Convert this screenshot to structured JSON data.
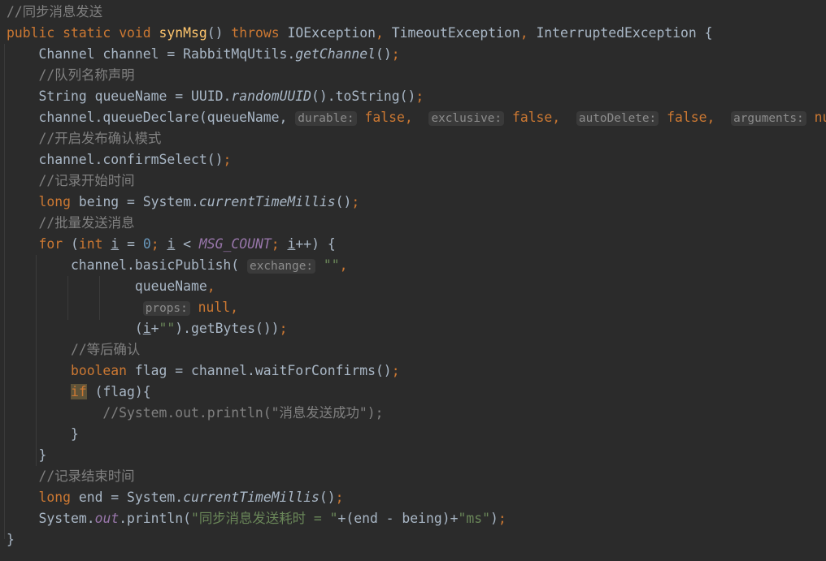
{
  "editor": {
    "language": "java",
    "theme": "darcula",
    "background_color": "#2b2b2b",
    "default_text_color": "#a9b7c6",
    "colors": {
      "keyword": "#cc7832",
      "comment": "#808080",
      "string": "#6a8759",
      "number": "#6897bb",
      "method_declaration": "#ffc66d",
      "static_field": "#9876aa",
      "parameter_hint_text": "#8c8c8c",
      "parameter_hint_background": "#3a3a3a",
      "caret_highlight_background": "#5e5339",
      "indent_guide": "#3b3b3b"
    },
    "lines": [
      {
        "indent": 0,
        "text": "//同步消息发送"
      },
      {
        "indent": 0,
        "text": "public static void synMsg() throws IOException, TimeoutException, InterruptedException {"
      },
      {
        "indent": 1,
        "text": "Channel channel = RabbitMqUtils.getChannel();"
      },
      {
        "indent": 1,
        "text": "//队列名称声明"
      },
      {
        "indent": 1,
        "text": "String queueName = UUID.randomUUID().toString();"
      },
      {
        "indent": 1,
        "text": "channel.queueDeclare(queueName, durable: false, exclusive: false, autoDelete: false, arguments: null);"
      },
      {
        "indent": 1,
        "text": "//开启发布确认模式"
      },
      {
        "indent": 1,
        "text": "channel.confirmSelect();"
      },
      {
        "indent": 1,
        "text": "//记录开始时间"
      },
      {
        "indent": 1,
        "text": "long being = System.currentTimeMillis();"
      },
      {
        "indent": 1,
        "text": "//批量发送消息"
      },
      {
        "indent": 1,
        "text": "for (int i = 0; i < MSG_COUNT; i++) {"
      },
      {
        "indent": 2,
        "text": "channel.basicPublish( exchange: \"\","
      },
      {
        "indent": 4,
        "text": "queueName,"
      },
      {
        "indent": 4,
        "text": " props: null,"
      },
      {
        "indent": 4,
        "text": "(i+\"\").getBytes());"
      },
      {
        "indent": 2,
        "text": "//等后确认"
      },
      {
        "indent": 2,
        "text": "boolean flag = channel.waitForConfirms();"
      },
      {
        "indent": 2,
        "text": "if (flag){"
      },
      {
        "indent": 3,
        "text": "//System.out.println(\"消息发送成功\");"
      },
      {
        "indent": 2,
        "text": "}"
      },
      {
        "indent": 1,
        "text": "}"
      },
      {
        "indent": 1,
        "text": "//记录结束时间"
      },
      {
        "indent": 1,
        "text": "long end = System.currentTimeMillis();"
      },
      {
        "indent": 1,
        "text": "System.out.println(\"同步消息发送耗时 = \"+(end - being)+\"ms\");"
      },
      {
        "indent": 0,
        "text": "}"
      }
    ],
    "parameter_hints": [
      {
        "label": "durable:",
        "value": "false"
      },
      {
        "label": "exclusive:",
        "value": "false"
      },
      {
        "label": "autoDelete:",
        "value": "false"
      },
      {
        "label": "arguments:",
        "value": "null"
      },
      {
        "label": "exchange:",
        "value": "\"\""
      },
      {
        "label": "props:",
        "value": "null"
      }
    ],
    "highlighted_token": "if",
    "comments": [
      "//同步消息发送",
      "//队列名称声明",
      "//开启发布确认模式",
      "//记录开始时间",
      "//批量发送消息",
      "//等后确认",
      "//System.out.println(\"消息发送成功\");",
      "//记录结束时间"
    ],
    "strings": [
      "\"\"",
      "\"\"",
      "\"同步消息发送耗时 = \"",
      "\"ms\""
    ],
    "identifiers": {
      "method_name": "synMsg",
      "exceptions": [
        "IOException",
        "TimeoutException",
        "InterruptedException"
      ],
      "types": [
        "Channel",
        "String",
        "long",
        "int",
        "boolean",
        "void"
      ],
      "variables": [
        "channel",
        "queueName",
        "being",
        "i",
        "flag",
        "end"
      ],
      "constants": [
        "MSG_COUNT"
      ],
      "classes": [
        "RabbitMqUtils",
        "UUID",
        "System"
      ],
      "methods": [
        "getChannel",
        "randomUUID",
        "toString",
        "queueDeclare",
        "confirmSelect",
        "currentTimeMillis",
        "basicPublish",
        "getBytes",
        "waitForConfirms",
        "println"
      ]
    }
  }
}
